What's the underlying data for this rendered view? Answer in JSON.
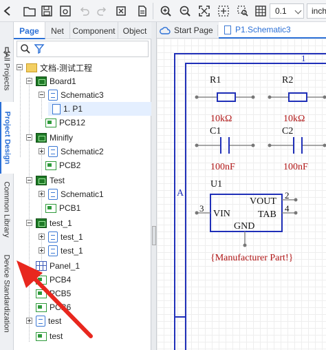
{
  "toolbar": {
    "zoom_value": "0.1",
    "unit_value": "inch"
  },
  "left_tabs": {
    "all_projects": "All Projects",
    "project_design": "Project Design",
    "common_library": "Common Library",
    "device_standardization": "Device Standardization"
  },
  "panel": {
    "tabs": [
      "Page",
      "Net",
      "Component",
      "Object"
    ]
  },
  "tree": {
    "root": "文档-测试工程",
    "board1": "Board1",
    "schematic3": "Schematic3",
    "p1": "1. P1",
    "pcb12": "PCB12",
    "minifly": "Minifly",
    "schematic2": "Schematic2",
    "pcb2": "PCB2",
    "test_board": "Test",
    "schematic1": "Schematic1",
    "pcb1": "PCB1",
    "test_1_board": "test_1",
    "test_1_sch_a": "test_1",
    "test_1_sch_b": "test_1",
    "panel_1": "Panel_1",
    "pcb4": "PCB4",
    "pcb5": "PCB5",
    "pcb6": "PCB6",
    "test_a": "test",
    "test_b": "test"
  },
  "doc_tabs": {
    "start_page": "Start Page",
    "schematic_tab": "P1.Schematic3"
  },
  "schematic": {
    "border_col_label": "1",
    "border_row_label": "A",
    "r1_designator": "R1",
    "r1_value": "10kΩ",
    "r2_designator": "R2",
    "r2_value": "10kΩ",
    "c1_designator": "C1",
    "c1_value": "100nF",
    "c2_designator": "C2",
    "c2_value": "100nF",
    "u1_designator": "U1",
    "pin_vin": "VIN",
    "pin_vout": "VOUT",
    "pin_tab": "TAB",
    "pin_gnd": "GND",
    "pin_num_3": "3",
    "pin_num_2": "2",
    "pin_num_4": "4",
    "manufacturer_part": "{Manufacturer Part!}"
  },
  "colors": {
    "accent": "#2a6fd6",
    "schematic_blue": "#1f2fb8",
    "schematic_red": "#b01515",
    "annotation_arrow": "#e8271e"
  }
}
